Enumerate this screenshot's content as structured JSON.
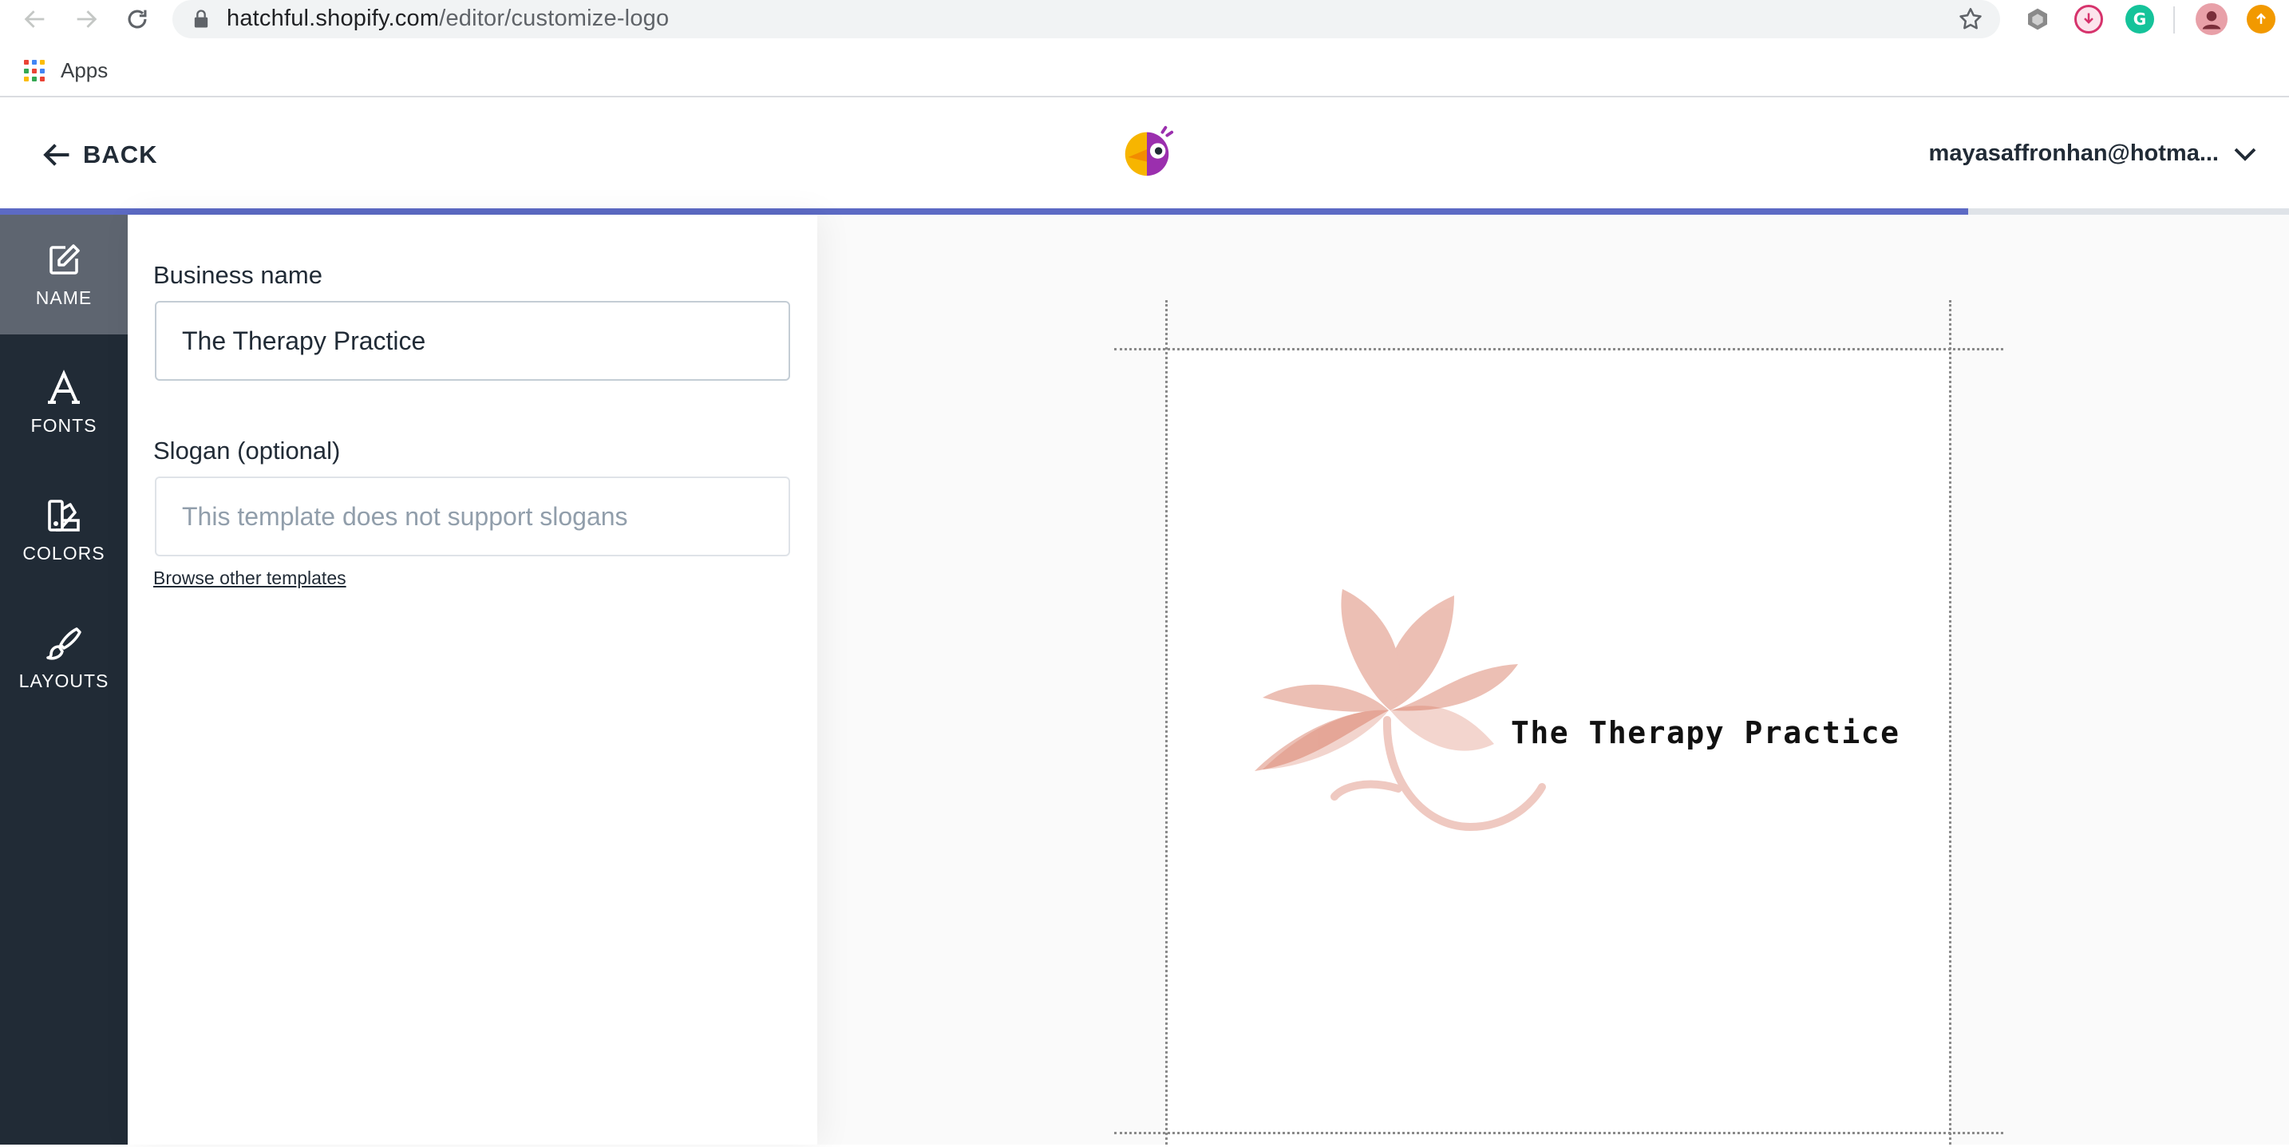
{
  "browser": {
    "url_host": "hatchful.shopify.com",
    "url_path": "/editor/customize-logo",
    "bookmarks": [
      {
        "label": "Apps"
      }
    ],
    "extensions": [
      {
        "name": "cube-extension-icon",
        "color": "#7a7a7a"
      },
      {
        "name": "download-extension-icon",
        "color": "#d6336c"
      },
      {
        "name": "grammarly-extension-icon",
        "color": "#15c39a",
        "glyph": "G"
      },
      {
        "name": "profile-avatar-icon",
        "color": "#e8a0a8"
      },
      {
        "name": "update-extension-icon",
        "color": "#f29900"
      }
    ]
  },
  "header": {
    "back_label": "BACK",
    "account_label": "mayasaffronhan@hotma...",
    "brand_logo_icon": "hatchful-parrot-logo-icon",
    "progress_percent": 86,
    "progress_color": "#5c6ac4"
  },
  "sidebar": {
    "items": [
      {
        "label": "NAME",
        "icon": "edit-icon",
        "active": true
      },
      {
        "label": "FONTS",
        "icon": "font-icon",
        "active": false
      },
      {
        "label": "COLORS",
        "icon": "color-swatch-icon",
        "active": false
      },
      {
        "label": "LAYOUTS",
        "icon": "brush-icon",
        "active": false
      }
    ]
  },
  "form": {
    "business_name_label": "Business name",
    "business_name_value": "The Therapy Practice",
    "slogan_label": "Slogan (optional)",
    "slogan_placeholder": "This template does not support slogans",
    "browse_link": "Browse other templates"
  },
  "preview": {
    "logo_text": "The Therapy Practice",
    "logo_icon": "lotus-flower-icon",
    "petal_color": "#d4684f"
  }
}
